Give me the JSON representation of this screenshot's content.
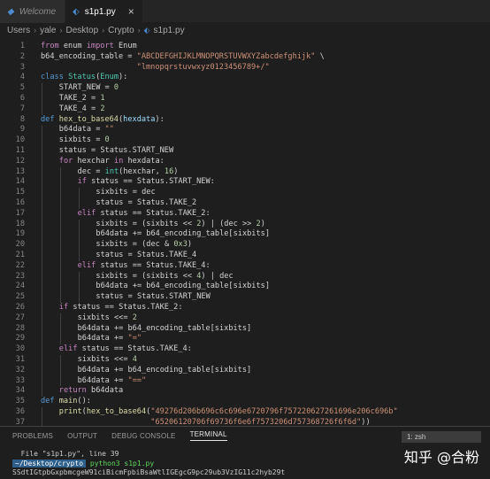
{
  "tabs": [
    {
      "label": "Welcome",
      "icon": "vscode-icon"
    },
    {
      "label": "s1p1.py",
      "icon": "python-icon",
      "close": "×"
    }
  ],
  "breadcrumb": [
    "Users",
    "yale",
    "Desktop",
    "Crypto",
    "s1p1.py"
  ],
  "editor": {
    "lines": [
      {
        "n": "1",
        "indent": 0,
        "tokens": [
          [
            "kw",
            "from"
          ],
          [
            "op",
            " enum "
          ],
          [
            "kw",
            "import"
          ],
          [
            "op",
            " Enum"
          ]
        ]
      },
      {
        "n": "2",
        "indent": 0,
        "tokens": [
          [
            "op",
            "b64_encoding_table = "
          ],
          [
            "str",
            "\"ABCDEFGHIJKLMNOPQRSTUVWXYZabcdefghijk\""
          ],
          [
            "op",
            " \\"
          ]
        ]
      },
      {
        "n": "3",
        "indent": 0,
        "tokens": [
          [
            "op",
            "                     "
          ],
          [
            "str",
            "\"lmnopqrstuvwxyz0123456789+/\""
          ]
        ]
      },
      {
        "n": "4",
        "indent": 0,
        "tokens": [
          [
            "kb",
            "class"
          ],
          [
            "op",
            " "
          ],
          [
            "cls",
            "Status"
          ],
          [
            "op",
            "("
          ],
          [
            "cls",
            "Enum"
          ],
          [
            "op",
            "):"
          ]
        ]
      },
      {
        "n": "5",
        "indent": 1,
        "tokens": [
          [
            "op",
            "START_NEW = "
          ],
          [
            "num",
            "0"
          ]
        ]
      },
      {
        "n": "6",
        "indent": 1,
        "tokens": [
          [
            "op",
            "TAKE_2 = "
          ],
          [
            "num",
            "1"
          ]
        ]
      },
      {
        "n": "7",
        "indent": 1,
        "tokens": [
          [
            "op",
            "TAKE_4 = "
          ],
          [
            "num",
            "2"
          ]
        ]
      },
      {
        "n": "8",
        "indent": 0,
        "tokens": [
          [
            "kb",
            "def"
          ],
          [
            "op",
            " "
          ],
          [
            "fn",
            "hex_to_base64"
          ],
          [
            "op",
            "("
          ],
          [
            "var",
            "hexdata"
          ],
          [
            "op",
            "):"
          ]
        ]
      },
      {
        "n": "9",
        "indent": 1,
        "tokens": [
          [
            "op",
            "b64data = "
          ],
          [
            "str",
            "\"\""
          ]
        ]
      },
      {
        "n": "10",
        "indent": 1,
        "tokens": [
          [
            "op",
            "sixbits = "
          ],
          [
            "num",
            "0"
          ]
        ]
      },
      {
        "n": "11",
        "indent": 1,
        "tokens": [
          [
            "op",
            "status = Status.START_NEW"
          ]
        ]
      },
      {
        "n": "12",
        "indent": 1,
        "tokens": [
          [
            "kw",
            "for"
          ],
          [
            "op",
            " hexchar "
          ],
          [
            "kw",
            "in"
          ],
          [
            "op",
            " hexdata:"
          ]
        ]
      },
      {
        "n": "13",
        "indent": 2,
        "tokens": [
          [
            "op",
            "dec = "
          ],
          [
            "cls",
            "int"
          ],
          [
            "op",
            "(hexchar, "
          ],
          [
            "num",
            "16"
          ],
          [
            "op",
            ")"
          ]
        ]
      },
      {
        "n": "14",
        "indent": 2,
        "tokens": [
          [
            "kw",
            "if"
          ],
          [
            "op",
            " status == Status.START_NEW:"
          ]
        ]
      },
      {
        "n": "15",
        "indent": 3,
        "tokens": [
          [
            "op",
            "sixbits = dec"
          ]
        ]
      },
      {
        "n": "16",
        "indent": 3,
        "tokens": [
          [
            "op",
            "status = Status.TAKE_2"
          ]
        ]
      },
      {
        "n": "17",
        "indent": 2,
        "tokens": [
          [
            "kw",
            "elif"
          ],
          [
            "op",
            " status == Status.TAKE_2:"
          ]
        ]
      },
      {
        "n": "18",
        "indent": 3,
        "tokens": [
          [
            "op",
            "sixbits = (sixbits << "
          ],
          [
            "num",
            "2"
          ],
          [
            "op",
            ") | (dec >> "
          ],
          [
            "num",
            "2"
          ],
          [
            "op",
            ")"
          ]
        ]
      },
      {
        "n": "19",
        "indent": 3,
        "tokens": [
          [
            "op",
            "b64data += b64_encoding_table[sixbits]"
          ]
        ]
      },
      {
        "n": "20",
        "indent": 3,
        "tokens": [
          [
            "op",
            "sixbits = (dec & "
          ],
          [
            "num",
            "0x3"
          ],
          [
            "op",
            ")"
          ]
        ]
      },
      {
        "n": "21",
        "indent": 3,
        "tokens": [
          [
            "op",
            "status = Status.TAKE_4"
          ]
        ]
      },
      {
        "n": "22",
        "indent": 2,
        "tokens": [
          [
            "kw",
            "elif"
          ],
          [
            "op",
            " status == Status.TAKE_4:"
          ]
        ]
      },
      {
        "n": "23",
        "indent": 3,
        "tokens": [
          [
            "op",
            "sixbits = (sixbits << "
          ],
          [
            "num",
            "4"
          ],
          [
            "op",
            ") | dec"
          ]
        ]
      },
      {
        "n": "24",
        "indent": 3,
        "tokens": [
          [
            "op",
            "b64data += b64_encoding_table[sixbits]"
          ]
        ]
      },
      {
        "n": "25",
        "indent": 3,
        "tokens": [
          [
            "op",
            "status = Status.START_NEW"
          ]
        ]
      },
      {
        "n": "26",
        "indent": 1,
        "tokens": [
          [
            "kw",
            "if"
          ],
          [
            "op",
            " status == Status.TAKE_2:"
          ]
        ]
      },
      {
        "n": "27",
        "indent": 2,
        "tokens": [
          [
            "op",
            "sixbits <<= "
          ],
          [
            "num",
            "2"
          ]
        ]
      },
      {
        "n": "28",
        "indent": 2,
        "tokens": [
          [
            "op",
            "b64data += b64_encoding_table[sixbits]"
          ]
        ]
      },
      {
        "n": "29",
        "indent": 2,
        "tokens": [
          [
            "op",
            "b64data += "
          ],
          [
            "str",
            "\"=\""
          ]
        ]
      },
      {
        "n": "30",
        "indent": 1,
        "tokens": [
          [
            "kw",
            "elif"
          ],
          [
            "op",
            " status == Status.TAKE_4:"
          ]
        ]
      },
      {
        "n": "31",
        "indent": 2,
        "tokens": [
          [
            "op",
            "sixbits <<= "
          ],
          [
            "num",
            "4"
          ]
        ]
      },
      {
        "n": "32",
        "indent": 2,
        "tokens": [
          [
            "op",
            "b64data += b64_encoding_table[sixbits]"
          ]
        ]
      },
      {
        "n": "33",
        "indent": 2,
        "tokens": [
          [
            "op",
            "b64data += "
          ],
          [
            "str",
            "\"==\""
          ]
        ]
      },
      {
        "n": "34",
        "indent": 1,
        "tokens": [
          [
            "kw",
            "return"
          ],
          [
            "op",
            " b64data"
          ]
        ]
      },
      {
        "n": "35",
        "indent": 0,
        "tokens": [
          [
            "kb",
            "def"
          ],
          [
            "op",
            " "
          ],
          [
            "fn",
            "main"
          ],
          [
            "op",
            "():"
          ]
        ]
      },
      {
        "n": "36",
        "indent": 1,
        "tokens": [
          [
            "fn",
            "print"
          ],
          [
            "op",
            "("
          ],
          [
            "fn",
            "hex_to_base64"
          ],
          [
            "op",
            "("
          ],
          [
            "str",
            "\"49276d206b696c6c696e6720796f757220627261696e206c696b\""
          ]
        ]
      },
      {
        "n": "37",
        "indent": 1,
        "tokens": [
          [
            "op",
            "                    "
          ],
          [
            "str",
            "\"65206120706f69736f6e6f7573206d757368726f6f6d\""
          ],
          [
            "op",
            "))"
          ]
        ]
      }
    ]
  },
  "panel": {
    "tabs": [
      "PROBLEMS",
      "OUTPUT",
      "DEBUG CONSOLE",
      "TERMINAL"
    ],
    "active_tab": "TERMINAL",
    "terminal_select": "1: zsh",
    "terminal_lines": {
      "line1": "  File \"s1p1.py\", line 39",
      "prompt_path": "~/Desktop/crypto",
      "prompt_cmd": "python3 s1p1.py",
      "output": "SSdtIGtpbGxpbmcgeW91ciBicmFpbiBsaWtlIGEgcG9pc29ub3VzIG11c2hyb29t"
    }
  },
  "watermark": "知乎 @合粉"
}
